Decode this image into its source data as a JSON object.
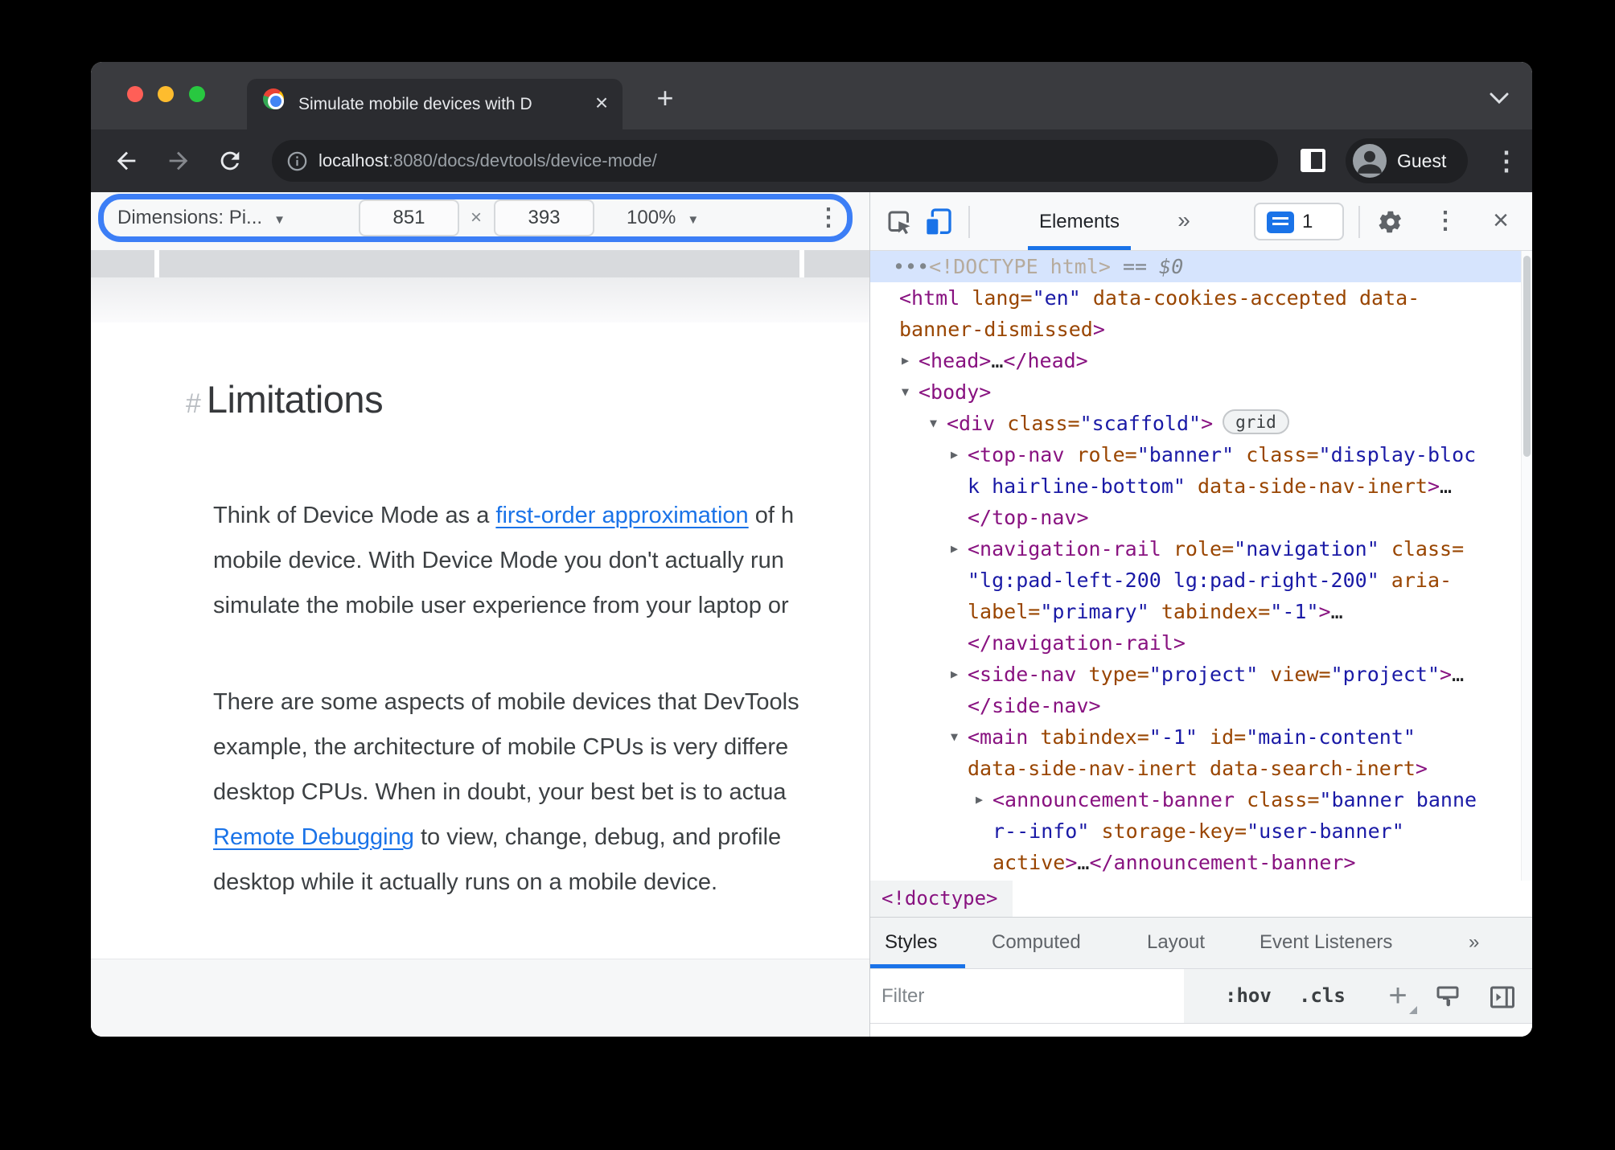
{
  "browser": {
    "tab_title": "Simulate mobile devices with D",
    "tab_close": "×",
    "new_tab": "+",
    "url_host": "localhost",
    "url_path": ":8080/docs/devtools/device-mode/",
    "guest_label": "Guest",
    "menu_dots": "⋮"
  },
  "device_toolbar": {
    "dimensions_label": "Dimensions: Pi...",
    "caret": "▼",
    "width_value": "851",
    "times": "×",
    "height_value": "393",
    "zoom_value": "100%",
    "menu_dots": "⋮",
    "annotation_color": "#3c7ef6"
  },
  "page": {
    "heading_hash": "#",
    "heading": "Limitations",
    "para1": [
      [
        {
          "t": "Think of Device Mode as a "
        },
        {
          "t": "first-order approximation",
          "link": true
        },
        {
          "t": " of h"
        }
      ],
      [
        {
          "t": "mobile device. With Device Mode you don't actually run"
        }
      ],
      [
        {
          "t": "simulate the mobile user experience from your laptop or"
        }
      ]
    ],
    "para2": [
      [
        {
          "t": "There are some aspects of mobile devices that DevTools"
        }
      ],
      [
        {
          "t": "example, the architecture of mobile CPUs is very differe"
        }
      ],
      [
        {
          "t": "desktop CPUs. When in doubt, your best bet is to actua"
        }
      ],
      [
        {
          "t": "Remote Debugging",
          "link": true
        },
        {
          "t": " to view, change, debug, and profile"
        }
      ],
      [
        {
          "t": "desktop while it actually runs on a mobile device."
        }
      ]
    ],
    "link_color": "#1a73e8"
  },
  "devtools": {
    "elements_tab": "Elements",
    "more_tabs": "»",
    "console_count": "1",
    "close": "×",
    "accent_color": "#1a73e8",
    "syntax_colors": {
      "tag": "#881280",
      "attr": "#994500",
      "value": "#1a1aa6",
      "doctype": "#b6ab9d"
    },
    "tree": [
      {
        "ind": 28,
        "sel": true,
        "seg": [
          {
            "c": "m",
            "t": "•••"
          },
          {
            "c": "d",
            "t": "<!DOCTYPE html>"
          },
          {
            "c": "m",
            "t": " == "
          },
          {
            "c": "mi",
            "t": "$0"
          }
        ]
      },
      {
        "ind": 36,
        "seg": [
          {
            "c": "t",
            "t": "<html "
          },
          {
            "c": "a",
            "t": "lang="
          },
          {
            "c": "v",
            "t": "\"en\""
          },
          {
            "c": "a",
            "t": " data-cookies-accepted data-"
          }
        ]
      },
      {
        "ind": 36,
        "seg": [
          {
            "c": "a",
            "t": "banner-dismissed"
          },
          {
            "c": "t",
            "t": ">"
          }
        ]
      },
      {
        "ind": 60,
        "arrow": "closed",
        "seg": [
          {
            "c": "t",
            "t": "<head>"
          },
          {
            "c": "p",
            "t": "…"
          },
          {
            "c": "t",
            "t": "</head>"
          }
        ]
      },
      {
        "ind": 60,
        "arrow": "open",
        "seg": [
          {
            "c": "t",
            "t": "<body>"
          }
        ]
      },
      {
        "ind": 95,
        "arrow": "open",
        "badge": "grid",
        "seg": [
          {
            "c": "t",
            "t": "<div "
          },
          {
            "c": "a",
            "t": "class="
          },
          {
            "c": "v",
            "t": "\"scaffold\""
          },
          {
            "c": "t",
            "t": ">"
          }
        ]
      },
      {
        "ind": 121,
        "arrow": "closed",
        "seg": [
          {
            "c": "t",
            "t": "<top-nav "
          },
          {
            "c": "a",
            "t": "role="
          },
          {
            "c": "v",
            "t": "\"banner\""
          },
          {
            "c": "a",
            "t": " class="
          },
          {
            "c": "v",
            "t": "\"display-bloc"
          }
        ]
      },
      {
        "ind": 121,
        "seg": [
          {
            "c": "v",
            "t": "k hairline-bottom\""
          },
          {
            "c": "a",
            "t": " data-side-nav-inert"
          },
          {
            "c": "t",
            "t": ">"
          },
          {
            "c": "p",
            "t": "…"
          }
        ]
      },
      {
        "ind": 121,
        "seg": [
          {
            "c": "t",
            "t": "</top-nav>"
          }
        ]
      },
      {
        "ind": 121,
        "arrow": "closed",
        "seg": [
          {
            "c": "t",
            "t": "<navigation-rail "
          },
          {
            "c": "a",
            "t": "role="
          },
          {
            "c": "v",
            "t": "\"navigation\""
          },
          {
            "c": "a",
            "t": " class="
          }
        ]
      },
      {
        "ind": 121,
        "seg": [
          {
            "c": "v",
            "t": "\"lg:pad-left-200 lg:pad-right-200\""
          },
          {
            "c": "a",
            "t": " aria-"
          }
        ]
      },
      {
        "ind": 121,
        "seg": [
          {
            "c": "a",
            "t": "label="
          },
          {
            "c": "v",
            "t": "\"primary\""
          },
          {
            "c": "a",
            "t": " tabindex="
          },
          {
            "c": "v",
            "t": "\"-1\""
          },
          {
            "c": "t",
            "t": ">"
          },
          {
            "c": "p",
            "t": "…"
          }
        ]
      },
      {
        "ind": 121,
        "seg": [
          {
            "c": "t",
            "t": "</navigation-rail>"
          }
        ]
      },
      {
        "ind": 121,
        "arrow": "closed",
        "seg": [
          {
            "c": "t",
            "t": "<side-nav "
          },
          {
            "c": "a",
            "t": "type="
          },
          {
            "c": "v",
            "t": "\"project\""
          },
          {
            "c": "a",
            "t": " view="
          },
          {
            "c": "v",
            "t": "\"project\""
          },
          {
            "c": "t",
            "t": ">"
          },
          {
            "c": "p",
            "t": "…"
          }
        ]
      },
      {
        "ind": 121,
        "seg": [
          {
            "c": "t",
            "t": "</side-nav>"
          }
        ]
      },
      {
        "ind": 121,
        "arrow": "open",
        "seg": [
          {
            "c": "t",
            "t": "<main "
          },
          {
            "c": "a",
            "t": "tabindex="
          },
          {
            "c": "v",
            "t": "\"-1\""
          },
          {
            "c": "a",
            "t": " id="
          },
          {
            "c": "v",
            "t": "\"main-content\""
          }
        ]
      },
      {
        "ind": 121,
        "seg": [
          {
            "c": "a",
            "t": "data-side-nav-inert data-search-inert"
          },
          {
            "c": "t",
            "t": ">"
          }
        ]
      },
      {
        "ind": 152,
        "arrow": "closed",
        "seg": [
          {
            "c": "t",
            "t": "<announcement-banner "
          },
          {
            "c": "a",
            "t": "class="
          },
          {
            "c": "v",
            "t": "\"banner banne"
          }
        ]
      },
      {
        "ind": 152,
        "seg": [
          {
            "c": "v",
            "t": "r--info\""
          },
          {
            "c": "a",
            "t": " storage-key="
          },
          {
            "c": "v",
            "t": "\"user-banner\""
          }
        ]
      },
      {
        "ind": 152,
        "seg": [
          {
            "c": "a",
            "t": "active"
          },
          {
            "c": "t",
            "t": ">"
          },
          {
            "c": "p",
            "t": "…"
          },
          {
            "c": "t",
            "t": "</announcement-banner>"
          }
        ]
      }
    ],
    "breadcrumb": "<!doctype>",
    "style_tabs": [
      {
        "label": "Styles",
        "active": true
      },
      {
        "label": "Computed",
        "active": false
      },
      {
        "label": "Layout",
        "active": false
      },
      {
        "label": "Event Listeners",
        "active": false
      },
      {
        "label": "»",
        "active": false
      }
    ],
    "filter_placeholder": "Filter",
    "hov_label": ":hov",
    "cls_label": ".cls",
    "plus_label": "+"
  }
}
